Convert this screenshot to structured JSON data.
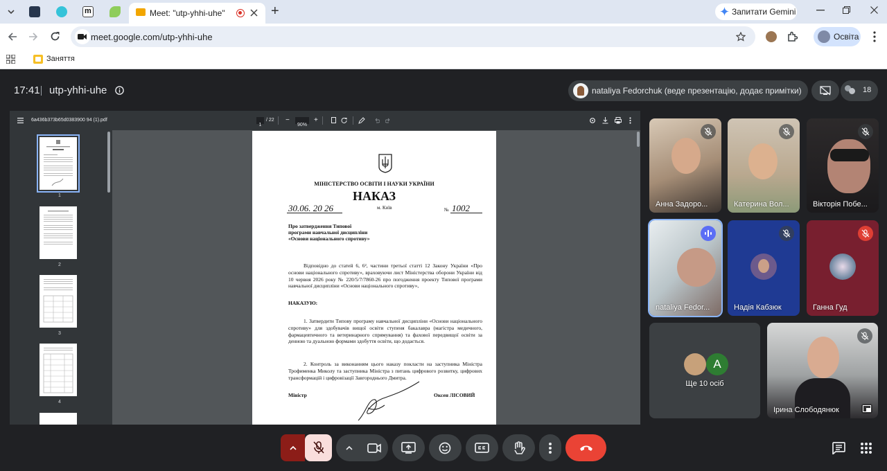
{
  "browser": {
    "tab_title": "Meet: \"utp-yhhi-uhe\"",
    "new_tab": "+",
    "gemini_label": "Запитати Gemini",
    "url": "meet.google.com/utp-yhhi-uhe",
    "profile_label": "Освіта",
    "bookmark_label": "Заняття"
  },
  "meet": {
    "time": "17:41",
    "meeting_code": "utp-yhhi-uhe",
    "presenter_label": "nataliya Fedorchuk (веде презентацію, додає примітки)",
    "participant_count": "18"
  },
  "pdf": {
    "filename": "6a436b373b65d0383900 94 (1).pdf",
    "page_current": "1",
    "page_total": "/ 22",
    "zoom": "90%",
    "thumbnail_labels": [
      "1",
      "2",
      "3",
      "4"
    ]
  },
  "document": {
    "ministry": "МІНІСТЕРСТВО ОСВІТИ І НАУКИ УКРАЇНИ",
    "title": "НАКАЗ",
    "date": "30.06. 20 26",
    "city": "м. Київ",
    "number_prefix": "№",
    "number": "1002",
    "subject_line1": "Про затвердження Типової",
    "subject_line2": "програми навчальної дисципліни",
    "subject_line3": "«Основи національного спротиву»",
    "preamble": "Відповідно до статей 6, 6², частини третьої статті 12 Закону України «Про основи національного спротиву», враховуючи лист Міністерства оборони України від 10 червня 2026 року № 220/5/7/7860-26 про погодження проекту Типової програми навчальної дисципліни «Основи національного спротиву»,",
    "order_word": "НАКАЗУЮ:",
    "item1": "1. Затвердити Типову програму навчальної дисципліни «Основи національного спротиву» для здобувачів вищої освіти ступеня бакалавра (магістра медичного, фармацевтичного та ветеринарного спрямування) та фахової передвищої освіти за денною та дуальною формами здобуття освіти, що додається.",
    "item2": "2. Контроль за виконанням цього наказу покласти на заступника Міністра Трофименка Миколу та заступника Міністра з питань цифрового розвитку, цифрових трансформацій і цифровізації Завгороднього Дмитра.",
    "signatory_title": "Міністр",
    "signatory_name": "Оксен ЛІСОВИЙ"
  },
  "participants": [
    {
      "name": "Анна Задоро...",
      "muted": true
    },
    {
      "name": "Катерина Вол...",
      "muted": true
    },
    {
      "name": "Вікторія Побе...",
      "muted": true
    },
    {
      "name": "nataliya Fedor...",
      "muted": false
    },
    {
      "name": "Надія Кабзюк",
      "muted": true
    },
    {
      "name": "Ганна Гуд",
      "muted": true
    },
    {
      "name": "Ірина Слободянюк",
      "muted": true
    }
  ],
  "others": {
    "label": "Ще 10 осіб",
    "avatar_letter": "A"
  },
  "colors": {
    "end_call": "#ea4335",
    "mic_off_bg": "#f9dedc",
    "active_outline": "#8ab4f8"
  }
}
